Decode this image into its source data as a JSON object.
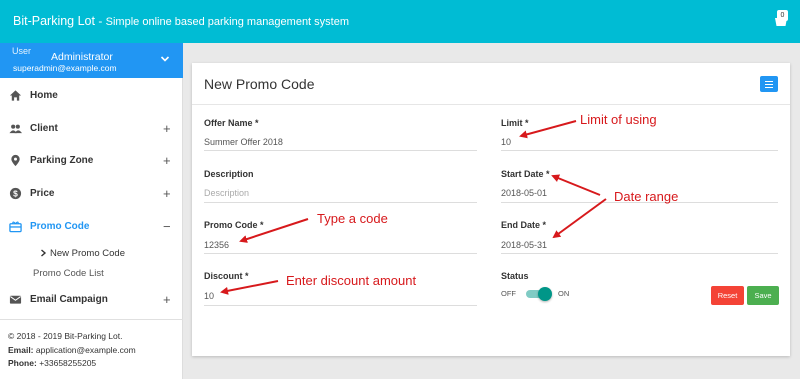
{
  "header": {
    "brand": "Bit-Parking Lot",
    "separator": " - ",
    "tagline": "Simple online based parking management system",
    "cart_count": "0"
  },
  "user": {
    "image_alt": "User",
    "name": "Administrator",
    "email": "superadmin@example.com"
  },
  "sidebar": {
    "items": [
      {
        "label": "Home",
        "icon": "home-icon"
      },
      {
        "label": "Client",
        "icon": "people-icon"
      },
      {
        "label": "Parking Zone",
        "icon": "location-pin-icon"
      },
      {
        "label": "Price",
        "icon": "dollar-icon"
      },
      {
        "label": "Promo Code",
        "icon": "gift-card-icon"
      },
      {
        "label": "Email Campaign",
        "icon": "mail-icon"
      }
    ],
    "plus": "+",
    "minus": "−",
    "sub_items": {
      "new_promo": "New Promo Code",
      "promo_list": "Promo Code List"
    },
    "active_color": "#2196f3"
  },
  "footer": {
    "copyright": "© 2018 - 2019 Bit-Parking Lot.",
    "email_label": "Email:",
    "email_value": "application@example.com",
    "phone_label": "Phone:",
    "phone_value": "+33658255205"
  },
  "form": {
    "title": "New Promo Code",
    "offer_name": {
      "label": "Offer Name *",
      "value": "Summer Offer 2018"
    },
    "description": {
      "label": "Description",
      "placeholder": "Description"
    },
    "promo_code": {
      "label": "Promo Code *",
      "value": "12356"
    },
    "discount": {
      "label": "Discount *",
      "value": "10"
    },
    "limit": {
      "label": "Limit *",
      "value": "10"
    },
    "start_date": {
      "label": "Start Date *",
      "value": "2018-05-01"
    },
    "end_date": {
      "label": "End Date *",
      "value": "2018-05-31"
    },
    "status": {
      "label": "Status",
      "off": "OFF",
      "on": "ON",
      "checked": true
    },
    "reset": "Reset",
    "save": "Save"
  },
  "annotations": {
    "limit": "Limit of using",
    "date_range": "Date range",
    "code": "Type a code",
    "discount": "Enter discount amount"
  },
  "colors": {
    "topbar": "#00bcd4",
    "user_panel": "#2196f3",
    "reset": "#f44336",
    "save": "#4caf50",
    "toggle": "#009688",
    "annotation": "#d7191c"
  }
}
